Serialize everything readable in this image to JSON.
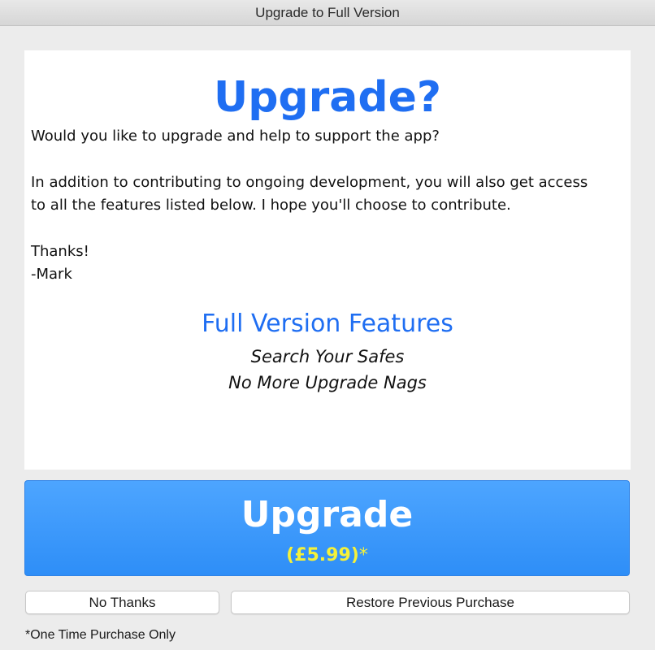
{
  "window": {
    "title": "Upgrade to Full Version"
  },
  "content": {
    "heading": "Upgrade?",
    "paragraph1": "Would you like to upgrade and help to support the app?",
    "paragraph2_line1": "In addition to contributing to ongoing development, you will also get access",
    "paragraph2_line2": "to all the features listed below.  I hope you'll choose to contribute.",
    "signoff_line1": "Thanks!",
    "signoff_line2": "-Mark",
    "features_title": "Full Version Features",
    "features": [
      "Search Your Safes",
      "No More Upgrade Nags"
    ]
  },
  "upgrade_button": {
    "label": "Upgrade",
    "price": "(£5.99)",
    "asterisk": "*"
  },
  "buttons": {
    "no_thanks": "No Thanks",
    "restore": "Restore Previous Purchase"
  },
  "footnote": "*One Time Purchase Only",
  "colors": {
    "accent": "#1f6ef2",
    "button_blue": "#3a98fb",
    "price_yellow": "#f5f13a"
  }
}
